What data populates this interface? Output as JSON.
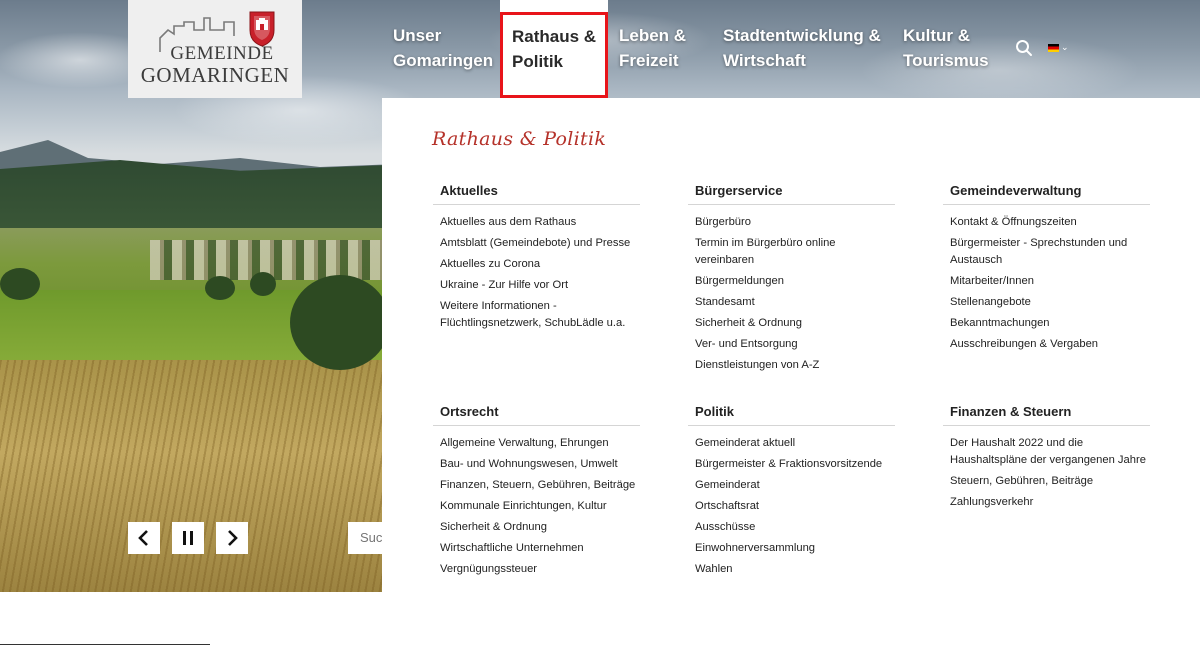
{
  "logo": {
    "line1": "GEMEINDE",
    "line2": "GOMARINGEN"
  },
  "nav": {
    "items": [
      {
        "line1": "Unser",
        "line2": "Gomaringen"
      },
      {
        "line1": "Rathaus &",
        "line2": "Politik"
      },
      {
        "line1": "Leben &",
        "line2": "Freizeit"
      },
      {
        "line1": "Stadtentwicklung &",
        "line2": "Wirtschaft"
      },
      {
        "line1": "Kultur &",
        "line2": "Tourismus"
      }
    ],
    "active_index": 1
  },
  "menu": {
    "title": "Rathaus & Politik",
    "columns": [
      {
        "heading": "Aktuelles",
        "items": [
          "Aktuelles aus dem Rathaus",
          "Amtsblatt (Gemeindebote) und Presse",
          "Aktuelles zu Corona",
          "Ukraine - Zur Hilfe vor Ort",
          "Weitere Informationen - Flüchtlingsnetzwerk, SchubLädle u.a."
        ]
      },
      {
        "heading": "Bürgerservice",
        "items": [
          "Bürgerbüro",
          "Termin im Bürgerbüro online vereinbaren",
          "Bürgermeldungen",
          "Standesamt",
          "Sicherheit & Ordnung",
          "Ver- und Entsorgung",
          "Dienstleistungen von A-Z"
        ]
      },
      {
        "heading": "Gemeindeverwaltung",
        "items": [
          "Kontakt & Öffnungszeiten",
          "Bürgermeister - Sprechstunden und Austausch",
          "Mitarbeiter/Innen",
          "Stellenangebote",
          "Bekanntmachungen",
          "Ausschreibungen & Vergaben"
        ]
      },
      {
        "heading": "Ortsrecht",
        "items": [
          "Allgemeine Verwaltung, Ehrungen",
          "Bau- und Wohnungswesen, Umwelt",
          "Finanzen, Steuern, Gebühren, Beiträge",
          "Kommunale Einrichtungen, Kultur",
          "Sicherheit & Ordnung",
          "Wirtschaftliche Unternehmen",
          "Vergnügungssteuer"
        ]
      },
      {
        "heading": "Politik",
        "items": [
          "Gemeinderat aktuell",
          "Bürgermeister & Fraktionsvorsitzende",
          "Gemeinderat",
          "Ortschaftsrat",
          "Ausschüsse",
          "Einwohnerversammlung",
          "Wahlen"
        ]
      },
      {
        "heading": "Finanzen & Steuern",
        "items": [
          "Der Haushalt 2022 und die Haushaltspläne der vergangenen Jahre",
          "Steuern, Gebühren, Beiträge",
          "Zahlungsverkehr"
        ]
      }
    ]
  },
  "slider": {
    "search_placeholder": "Suche"
  },
  "icons": {
    "search": "search-icon",
    "language": "german-flag-icon",
    "prev": "chevron-left-icon",
    "pause": "pause-icon",
    "next": "chevron-right-icon"
  },
  "colors": {
    "accent_red": "#b5322a",
    "active_border": "#e8141a"
  }
}
